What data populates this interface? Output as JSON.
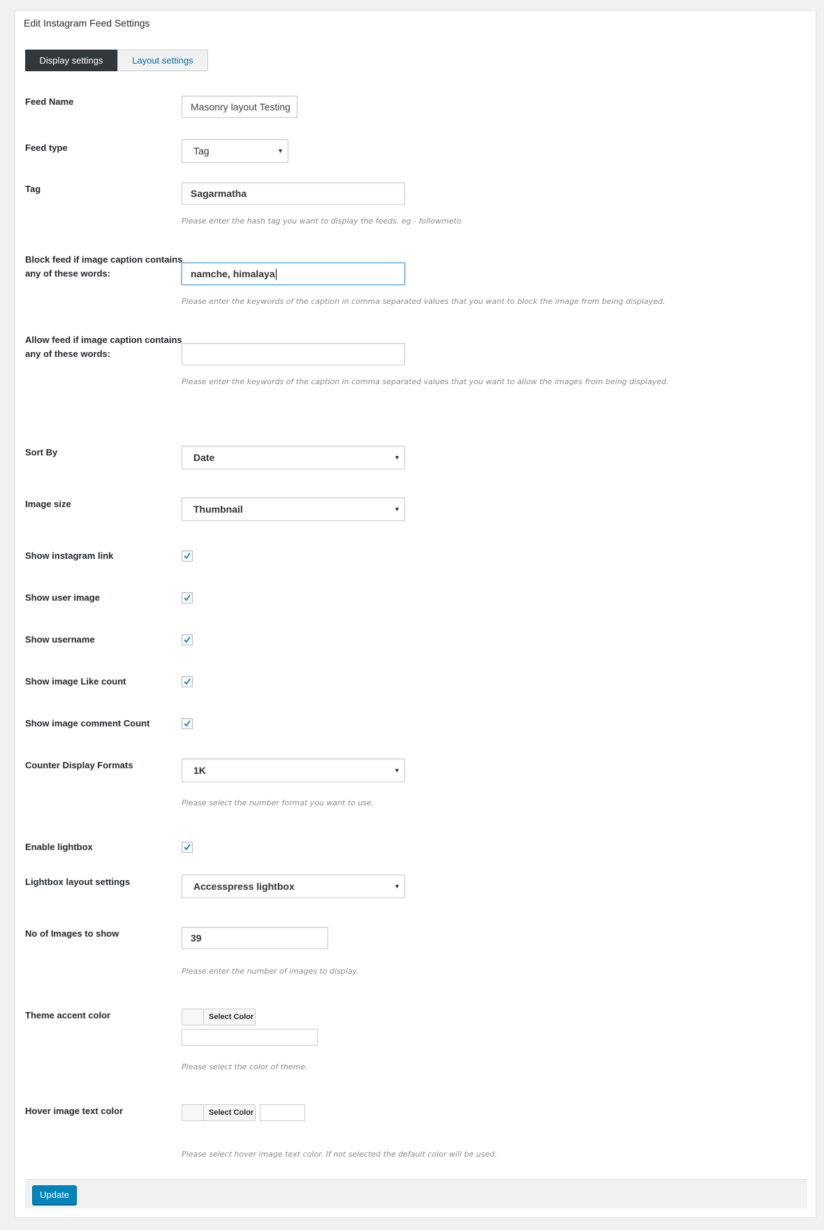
{
  "panel": {
    "title": "Edit Instagram Feed Settings"
  },
  "tabs": [
    {
      "label": "Display settings"
    },
    {
      "label": "Layout settings"
    }
  ],
  "fields": {
    "feed_name": {
      "label": "Feed Name",
      "value": "Masonry layout Testing"
    },
    "feed_type": {
      "label": "Feed type",
      "value": "Tag"
    },
    "tag": {
      "label": "Tag",
      "value": "Sagarmatha",
      "hint": "Please enter the hash tag you want to display the feeds. eg - followmeto"
    },
    "block_words": {
      "label": "Block feed if image caption contains any of these words:",
      "value": "namche, himalaya",
      "hint": "Please enter the keywords of the caption in comma separated values that you want to block the image from being displayed."
    },
    "allow_words": {
      "label": "Allow feed if image caption contains any of these words:",
      "value": "",
      "hint": "Please enter the keywords of the caption in comma separated values that you want to allow the images from being displayed."
    },
    "sort_by": {
      "label": "Sort By",
      "value": "Date"
    },
    "image_size": {
      "label": "Image size",
      "value": "Thumbnail"
    },
    "show_instagram_link": {
      "label": "Show instagram link",
      "checked": true
    },
    "show_user_image": {
      "label": "Show user image",
      "checked": true
    },
    "show_username": {
      "label": "Show username",
      "checked": true
    },
    "show_like_count": {
      "label": "Show image Like count",
      "checked": true
    },
    "show_comment_count": {
      "label": "Show image comment Count",
      "checked": true
    },
    "counter_format": {
      "label": "Counter Display Formats",
      "value": "1K",
      "hint": "Please select the number format you want to use."
    },
    "enable_lightbox": {
      "label": "Enable lightbox",
      "checked": true
    },
    "lightbox_layout": {
      "label": "Lightbox layout settings",
      "value": "Accesspress lightbox"
    },
    "num_images": {
      "label": "No of Images to show",
      "value": "39",
      "hint": "Please enter the number of images to display."
    },
    "theme_accent_color": {
      "label": "Theme accent color",
      "button": "Select Color",
      "value": "",
      "hint": "Please select the color of theme."
    },
    "hover_text_color": {
      "label": "Hover image text color",
      "button": "Select Color",
      "value": "",
      "hint": "Please select hover image text color. If not selected the default color will be used."
    }
  },
  "footer": {
    "update_label": "Update"
  },
  "colors": {
    "accent": "#0085ba",
    "active_tab": "#32373c",
    "link": "#0073aa",
    "check": "#1e8cbe"
  },
  "icons": {
    "checkbox": "checkmark-icon",
    "select": "dropdown-arrow-icon"
  }
}
